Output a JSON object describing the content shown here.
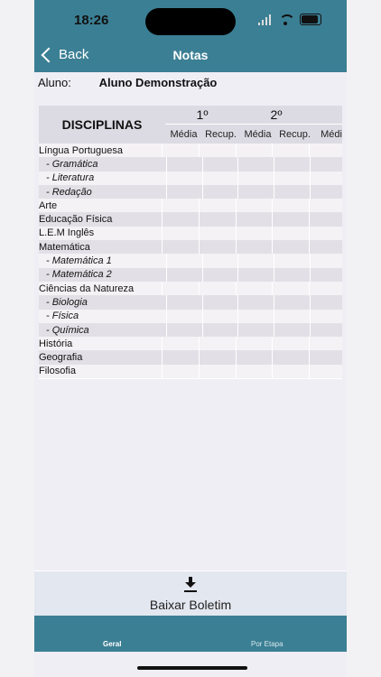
{
  "status": {
    "time": "18:26"
  },
  "nav": {
    "back": "Back",
    "title": "Notas"
  },
  "aluno": {
    "label": "Aluno:",
    "name": "Aluno Demonstração"
  },
  "table": {
    "header": "DISCIPLINAS",
    "periods": [
      "1º",
      "2º"
    ],
    "subheaders": [
      "Média",
      "Recup.",
      "Média",
      "Recup.",
      "Médi"
    ],
    "rows": [
      "Língua Portuguesa",
      "- Gramática",
      "- Literatura",
      "- Redação",
      "Arte",
      "Educação Física",
      "L.E.M Inglês",
      "Matemática",
      "- Matemática 1",
      "- Matemática 2",
      "Ciências da Natureza",
      "- Biologia",
      "- Física",
      "- Química",
      "História",
      "Geografia",
      "Filosofia"
    ]
  },
  "download": {
    "label": "Baixar Boletim"
  },
  "tabs": {
    "geral": "Geral",
    "etapa": "Por Etapa"
  }
}
